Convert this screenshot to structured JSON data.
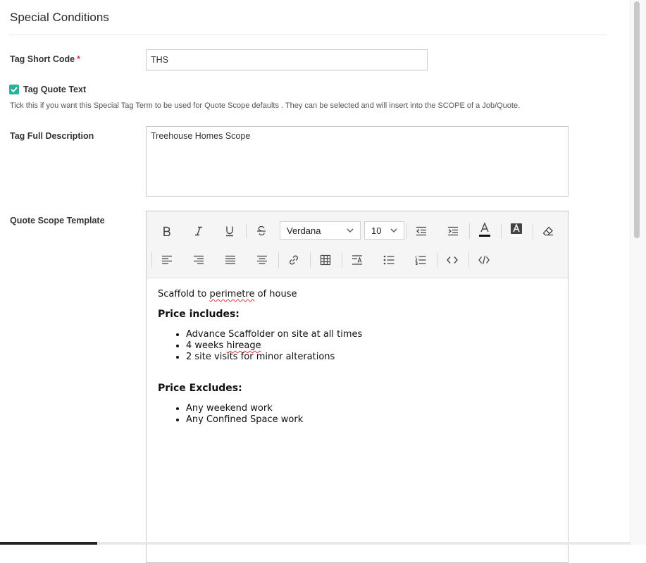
{
  "page": {
    "title": "Special Conditions"
  },
  "form": {
    "short_code": {
      "label": "Tag Short Code",
      "required_marker": "*",
      "value": "THS"
    },
    "quote_text": {
      "label": "Tag Quote Text",
      "checked": true,
      "help": "Tick this if you want this Special Tag Term to be used for Quote Scope defaults . They can be selected and will insert into the SCOPE of a Job/Quote."
    },
    "full_description": {
      "label": "Tag Full Description",
      "value": "Treehouse Homes Scope"
    },
    "scope_template": {
      "label": "Quote Scope Template"
    }
  },
  "editor": {
    "toolbar": {
      "row1": [
        "bold-icon",
        "italic-icon",
        "underline-icon",
        "strikethrough-icon",
        "font-family-select",
        "font-size-select",
        "outdent-icon",
        "indent-icon",
        "font-color-icon",
        "highlight-icon",
        "clear-format-icon"
      ],
      "row2": [
        "align-left-icon",
        "align-right-icon",
        "justify-icon",
        "align-center-icon",
        "link-icon",
        "table-icon",
        "line-height-icon",
        "bullet-list-icon",
        "numbered-list-icon",
        "code-view-icon",
        "source-icon"
      ],
      "font_family": "Verdana",
      "font_size": "10"
    },
    "content": {
      "intro": {
        "before": "Scaffold to ",
        "misspelled": "perimetre",
        "after": " of house"
      },
      "includes_heading": "Price includes:",
      "includes": [
        {
          "text": "Advance Scaffolder on site at all times"
        },
        {
          "before": "4 weeks ",
          "misspelled": "hireage"
        },
        {
          "text": "2 site visits for minor alterations"
        }
      ],
      "excludes_heading": "Price Excludes:",
      "excludes": [
        "Any weekend work",
        "Any Confined Space work"
      ]
    }
  },
  "colors": {
    "accent": "#27b397",
    "required": "#e0393e"
  }
}
